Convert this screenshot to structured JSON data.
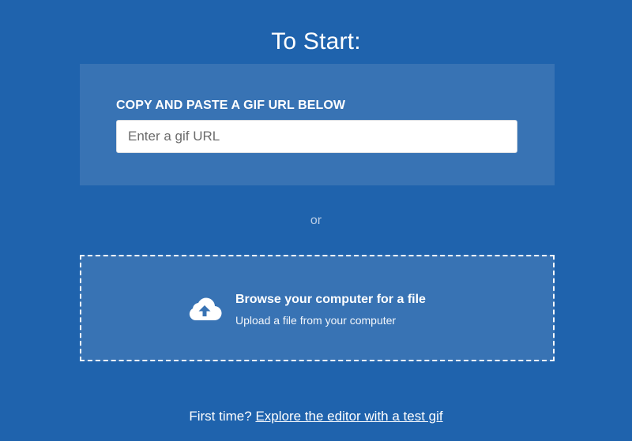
{
  "header": {
    "title": "To Start:"
  },
  "url_panel": {
    "label": "COPY AND PASTE A GIF URL BELOW",
    "input_placeholder": "Enter a gif URL",
    "input_value": ""
  },
  "divider": {
    "text": "or"
  },
  "upload": {
    "icon": "cloud-upload-icon",
    "title": "Browse your computer for a file",
    "subtitle": "Upload a file from your computer"
  },
  "footer": {
    "prompt": "First time?",
    "link_text": "Explore the editor with a test gif"
  },
  "colors": {
    "background": "#1f63ad",
    "panel": "#3873b4",
    "text": "#ffffff"
  }
}
